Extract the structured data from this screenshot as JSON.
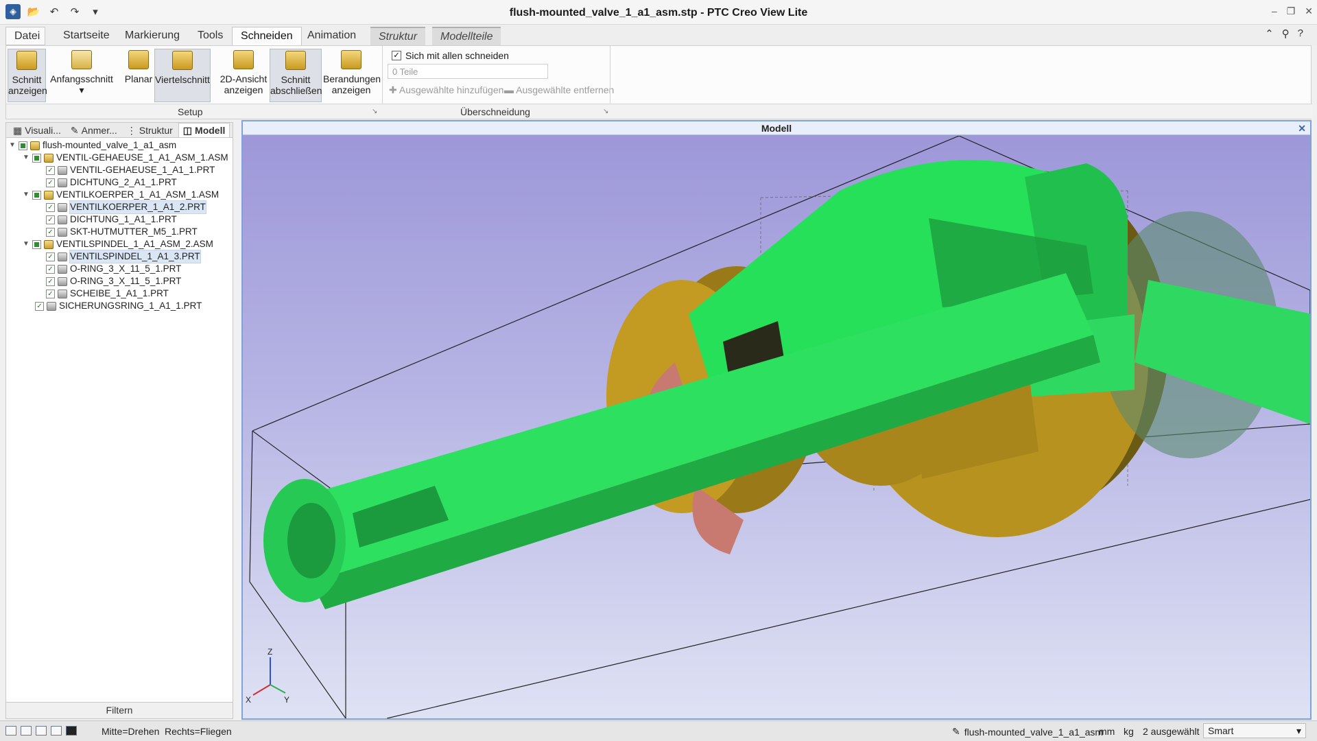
{
  "window": {
    "title": "flush-mounted_valve_1_a1_asm.stp - PTC Creo View Lite"
  },
  "tabs": {
    "file": "Datei",
    "home": "Startseite",
    "markup": "Markierung",
    "tools": "Tools",
    "section": "Schneiden",
    "animation": "Animation",
    "structure": "Struktur",
    "parts": "Modellteile"
  },
  "ribbon": {
    "show_section": "Schnitt anzeigen",
    "initial_section": "Anfangsschnitt",
    "planar": "Planar",
    "quarter_section": "Viertelschnitt",
    "view_2d": "2D-Ansicht anzeigen",
    "close_section": "Schnitt abschließen",
    "show_boundaries": "Berandungen anzeigen",
    "group_setup": "Setup",
    "group_intersection": "Überschneidung",
    "cut_all_label": "Sich mit allen schneiden",
    "parts_count": "0 Teile",
    "add_selected": "Ausgewählte hinzufügen",
    "remove_selected": "Ausgewählte entfernen"
  },
  "panel": {
    "tabs": [
      "Visuali...",
      "Anmer...",
      "Struktur",
      "Modell"
    ],
    "filter": "Filtern"
  },
  "tree": [
    {
      "label": "flush-mounted_valve_1_a1_asm",
      "depth": 0,
      "kind": "asm"
    },
    {
      "label": "VENTIL-GEHAEUSE_1_A1_ASM_1.ASM",
      "depth": 1,
      "kind": "asm"
    },
    {
      "label": "VENTIL-GEHAEUSE_1_A1_1.PRT",
      "depth": 2,
      "kind": "prt"
    },
    {
      "label": "DICHTUNG_2_A1_1.PRT",
      "depth": 2,
      "kind": "prt"
    },
    {
      "label": "VENTILKOERPER_1_A1_ASM_1.ASM",
      "depth": 1,
      "kind": "asm"
    },
    {
      "label": "VENTILKOERPER_1_A1_2.PRT",
      "depth": 2,
      "kind": "prt",
      "selected": true
    },
    {
      "label": "DICHTUNG_1_A1_1.PRT",
      "depth": 2,
      "kind": "prt"
    },
    {
      "label": "SKT-HUTMUTTER_M5_1.PRT",
      "depth": 2,
      "kind": "prt"
    },
    {
      "label": "VENTILSPINDEL_1_A1_ASM_2.ASM",
      "depth": 1,
      "kind": "asm"
    },
    {
      "label": "VENTILSPINDEL_1_A1_3.PRT",
      "depth": 2,
      "kind": "prt",
      "selected": true
    },
    {
      "label": "O-RING_3_X_11_5_1.PRT",
      "depth": 2,
      "kind": "prt"
    },
    {
      "label": "O-RING_3_X_11_5_1.PRT",
      "depth": 2,
      "kind": "prt"
    },
    {
      "label": "SCHEIBE_1_A1_1.PRT",
      "depth": 2,
      "kind": "prt"
    },
    {
      "label": "SICHERUNGSRING_1_A1_1.PRT",
      "depth": 1,
      "kind": "prt"
    }
  ],
  "viewport": {
    "title": "Modell",
    "axes": {
      "x": "X",
      "y": "Y",
      "z": "Z"
    }
  },
  "status": {
    "middle": "Mitte=Drehen",
    "right": "Rechts=Fliegen",
    "model": "flush-mounted_valve_1_a1_asm",
    "unit_length": "mm",
    "unit_mass": "kg",
    "selected": "2 ausgewählt",
    "mode": "Smart"
  }
}
